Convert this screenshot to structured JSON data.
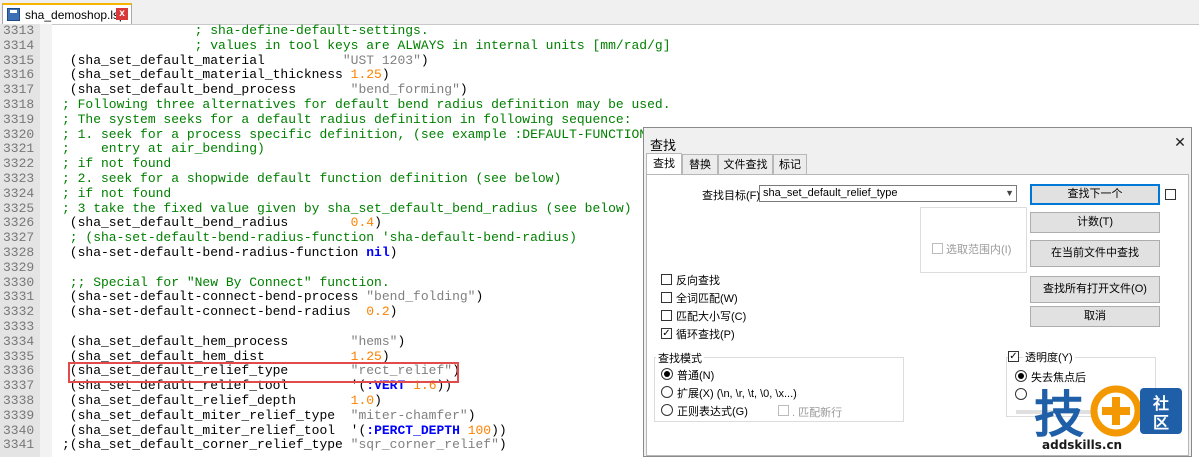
{
  "tab": {
    "filename": "sha_demoshop.lsp",
    "close_glyph": "x"
  },
  "editor": {
    "lines": [
      {
        "n": "3313",
        "parts": [
          {
            "t": "                 ; sha-define-default-settings.",
            "c": "c"
          }
        ]
      },
      {
        "n": "3314",
        "parts": [
          {
            "t": "                 ; values in tool keys are ALWAYS in internal units [mm/rad/g]",
            "c": "c"
          }
        ]
      },
      {
        "n": "3315",
        "parts": [
          {
            "t": " (sha_set_default_material          ",
            "c": ""
          },
          {
            "t": "\"UST 1203\"",
            "c": "s"
          },
          {
            "t": ")",
            "c": ""
          }
        ]
      },
      {
        "n": "3316",
        "parts": [
          {
            "t": " (sha_set_default_material_thickness ",
            "c": ""
          },
          {
            "t": "1.25",
            "c": "n"
          },
          {
            "t": ")",
            "c": ""
          }
        ]
      },
      {
        "n": "3317",
        "parts": [
          {
            "t": " (sha_set_default_bend_process       ",
            "c": ""
          },
          {
            "t": "\"bend_forming\"",
            "c": "s"
          },
          {
            "t": ")",
            "c": ""
          }
        ]
      },
      {
        "n": "3318",
        "parts": [
          {
            "t": "; Following three alternatives for default bend radius definition may be used.",
            "c": "c"
          }
        ]
      },
      {
        "n": "3319",
        "parts": [
          {
            "t": "; The system seeks for a default radius definition in following sequence:",
            "c": "c"
          }
        ]
      },
      {
        "n": "3320",
        "parts": [
          {
            "t": "; 1. seek for a process specific definition, (see example :DEFAULT-FUNCTION",
            "c": "c"
          }
        ]
      },
      {
        "n": "3321",
        "parts": [
          {
            "t": ";    entry at air_bending)",
            "c": "c"
          }
        ]
      },
      {
        "n": "3322",
        "parts": [
          {
            "t": "; if not found",
            "c": "c"
          }
        ]
      },
      {
        "n": "3323",
        "parts": [
          {
            "t": "; 2. seek for a shopwide default function definition (see below)",
            "c": "c"
          }
        ]
      },
      {
        "n": "3324",
        "parts": [
          {
            "t": "; if not found",
            "c": "c"
          }
        ]
      },
      {
        "n": "3325",
        "parts": [
          {
            "t": "; 3 take the fixed value given by sha_set_default_bend_radius (see below)",
            "c": "c"
          }
        ]
      },
      {
        "n": "3326",
        "parts": [
          {
            "t": " (sha_set_default_bend_radius        ",
            "c": ""
          },
          {
            "t": "0.4",
            "c": "n"
          },
          {
            "t": ")",
            "c": ""
          }
        ]
      },
      {
        "n": "3327",
        "parts": [
          {
            "t": " ; (sha-set-default-bend-radius-function 'sha-default-bend-radius)",
            "c": "c"
          }
        ]
      },
      {
        "n": "3328",
        "parts": [
          {
            "t": " (sha-set-default-bend-radius-function ",
            "c": ""
          },
          {
            "t": "nil",
            "c": "k"
          },
          {
            "t": ")",
            "c": ""
          }
        ]
      },
      {
        "n": "3329",
        "parts": [
          {
            "t": "",
            "c": ""
          }
        ]
      },
      {
        "n": "3330",
        "parts": [
          {
            "t": " ;; Special for \"New By Connect\" function.",
            "c": "c"
          }
        ]
      },
      {
        "n": "3331",
        "parts": [
          {
            "t": " (sha-set-default-connect-bend-process ",
            "c": ""
          },
          {
            "t": "\"bend_folding\"",
            "c": "s"
          },
          {
            "t": ")",
            "c": ""
          }
        ]
      },
      {
        "n": "3332",
        "parts": [
          {
            "t": " (sha-set-default-connect-bend-radius  ",
            "c": ""
          },
          {
            "t": "0.2",
            "c": "n"
          },
          {
            "t": ")",
            "c": ""
          }
        ]
      },
      {
        "n": "3333",
        "parts": [
          {
            "t": "",
            "c": ""
          }
        ]
      },
      {
        "n": "3334",
        "parts": [
          {
            "t": " (sha_set_default_hem_process        ",
            "c": ""
          },
          {
            "t": "\"hems\"",
            "c": "s"
          },
          {
            "t": ")",
            "c": ""
          }
        ]
      },
      {
        "n": "3335",
        "parts": [
          {
            "t": " (sha_set_default_hem_dist           ",
            "c": ""
          },
          {
            "t": "1.25",
            "c": "n"
          },
          {
            "t": ")",
            "c": ""
          }
        ]
      },
      {
        "n": "3336",
        "parts": [
          {
            "t": " (sha_set_default_relief_type        ",
            "c": ""
          },
          {
            "t": "\"rect_relief\"",
            "c": "s"
          },
          {
            "t": ")",
            "c": ""
          }
        ]
      },
      {
        "n": "3337",
        "parts": [
          {
            "t": " (sha_set_default_relief_tool        ",
            "c": ""
          },
          {
            "t": "'(",
            "c": ""
          },
          {
            "t": ":VERT",
            "c": "k"
          },
          {
            "t": " ",
            "c": ""
          },
          {
            "t": "1.6",
            "c": "n"
          },
          {
            "t": "))",
            "c": ""
          }
        ]
      },
      {
        "n": "3338",
        "parts": [
          {
            "t": " (sha_set_default_relief_depth       ",
            "c": ""
          },
          {
            "t": "1.0",
            "c": "n"
          },
          {
            "t": ")",
            "c": ""
          }
        ]
      },
      {
        "n": "3339",
        "parts": [
          {
            "t": " (sha_set_default_miter_relief_type  ",
            "c": ""
          },
          {
            "t": "\"miter-chamfer\"",
            "c": "s"
          },
          {
            "t": ")",
            "c": ""
          }
        ]
      },
      {
        "n": "3340",
        "parts": [
          {
            "t": " (sha_set_default_miter_relief_tool  ",
            "c": ""
          },
          {
            "t": "'(",
            "c": ""
          },
          {
            "t": ":PERCT_DEPTH",
            "c": "k"
          },
          {
            "t": " ",
            "c": ""
          },
          {
            "t": "100",
            "c": "n"
          },
          {
            "t": "))",
            "c": ""
          }
        ]
      },
      {
        "n": "3341",
        "parts": [
          {
            "t": ";(sha_set_default_corner_relief_type ",
            "c": ""
          },
          {
            "t": "\"sqr_corner_relief\"",
            "c": "s"
          },
          {
            "t": ")",
            "c": ""
          }
        ]
      }
    ]
  },
  "find_dialog": {
    "title": "查找",
    "close_glyph": "✕",
    "tabs": [
      "查找",
      "替换",
      "文件查找",
      "标记"
    ],
    "active_tab": "查找",
    "find_label": "查找目标(F) :",
    "find_value": "sha_set_default_relief_type",
    "buttons": {
      "find_next": "查找下一个",
      "count": "计数(T)",
      "find_in_current": "在当前文件中查找",
      "find_all_open": "查找所有打开文件(O)",
      "cancel": "取消"
    },
    "in_selection": "选取范围内(I)",
    "options": [
      {
        "label": "反向查找",
        "checked": false
      },
      {
        "label": "全词匹配(W)",
        "checked": false
      },
      {
        "label": "匹配大小写(C)",
        "checked": false
      },
      {
        "label": "循环查找(P)",
        "checked": true
      }
    ],
    "search_mode": {
      "title": "查找模式",
      "items": [
        {
          "label": "普通(N)",
          "selected": true
        },
        {
          "label": "扩展(X) (\\n, \\r, \\t, \\0, \\x...)",
          "selected": false
        },
        {
          "label": "正则表达式(G)",
          "selected": false
        }
      ],
      "dot_newline": ". 匹配新行"
    },
    "transparency": {
      "label": "透明度(Y)",
      "checked": true,
      "on_lose_focus": "失去焦点后",
      "on_lose_focus_selected": true
    }
  },
  "watermark": {
    "logo_char": "技",
    "logo_side": "社区",
    "site": "addskills.cn"
  },
  "colors": {
    "comment": "#008000",
    "string": "#808080",
    "number": "#ff8000",
    "keyword": "#0000ff",
    "highlight_box": "#e24b4b",
    "accent": "#0078d7"
  }
}
